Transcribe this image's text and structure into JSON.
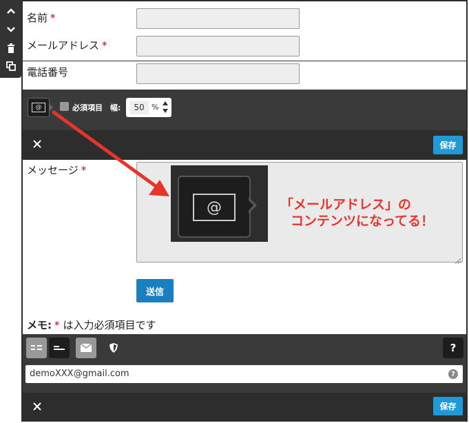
{
  "form": {
    "name_label": "名前",
    "email_label": "メールアドレス",
    "phone_label": "電話番号",
    "message_label": "メッセージ",
    "required_mark": "*",
    "submit_label": "送信",
    "memo_prefix": "メモ:",
    "memo_suffix": "は入力必須項目です"
  },
  "field_settings": {
    "type_icon": "@",
    "required_label": "必須項目",
    "width_label": "幅:",
    "width_value": "50",
    "width_unit": "%",
    "save_label": "保存"
  },
  "annotation": {
    "line1": "「メールアドレス」の",
    "line2": "コンテンツになってる！",
    "zoom_icon": "@"
  },
  "bottom_editor": {
    "help_label": "?",
    "value": "demoXXX@gmail.com",
    "save_label": "保存"
  }
}
